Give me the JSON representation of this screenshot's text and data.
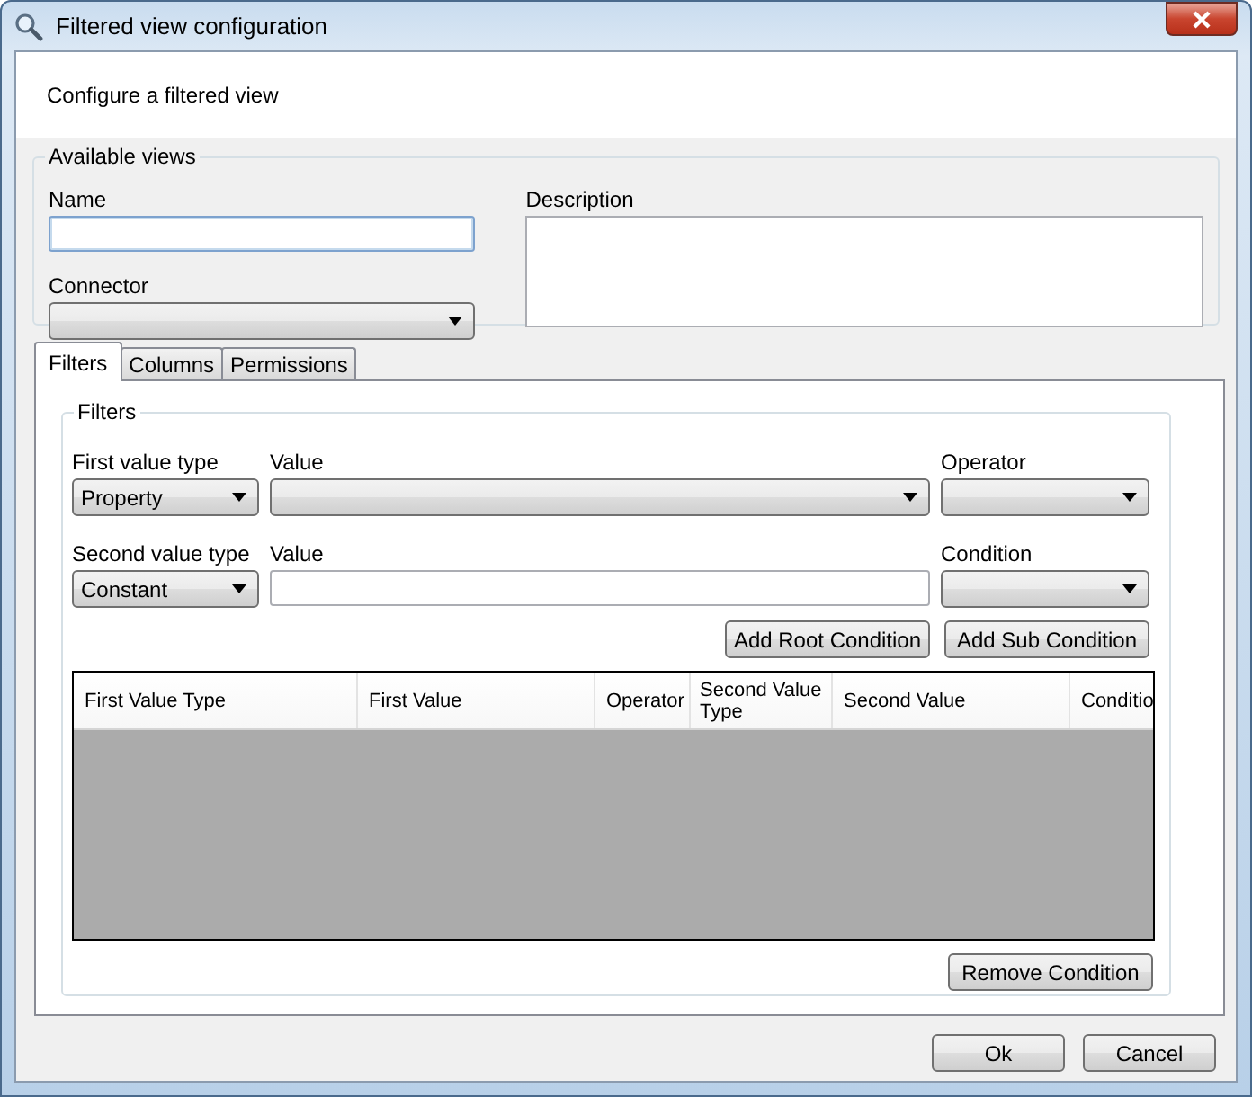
{
  "window": {
    "title": "Filtered view configuration"
  },
  "header": {
    "text": "Configure a filtered view"
  },
  "available_views": {
    "title": "Available views",
    "name_field": {
      "label": "Name",
      "focused": true
    },
    "connector": {
      "label": "Connector"
    },
    "description": {
      "label": "Description"
    }
  },
  "tabs": [
    {
      "label": "Filters",
      "selected": true
    },
    {
      "label": "Columns",
      "selected": false
    },
    {
      "label": "Permissions",
      "selected": false
    }
  ],
  "filters": {
    "title": "Filters",
    "fields": [
      {
        "label": "First value type",
        "kind": "dropdown",
        "value": "Property"
      },
      {
        "label": "Value",
        "kind": "dropdown"
      },
      {
        "label": "Operator",
        "kind": "dropdown"
      },
      {
        "label": "Second value type",
        "kind": "dropdown",
        "value": "Constant"
      },
      {
        "label": "Value",
        "kind": "text"
      },
      {
        "label": "Condition",
        "kind": "dropdown"
      }
    ],
    "buttons": [
      "Add Root Condition",
      "Add Sub Condition"
    ],
    "table": {
      "columns": [
        "First Value Type",
        "First Value",
        "Operator",
        "Second Value Type",
        "Second Value",
        "Conditio"
      ]
    },
    "remove_button": "Remove Condition"
  },
  "buttons": [
    "Ok",
    "Cancel"
  ]
}
